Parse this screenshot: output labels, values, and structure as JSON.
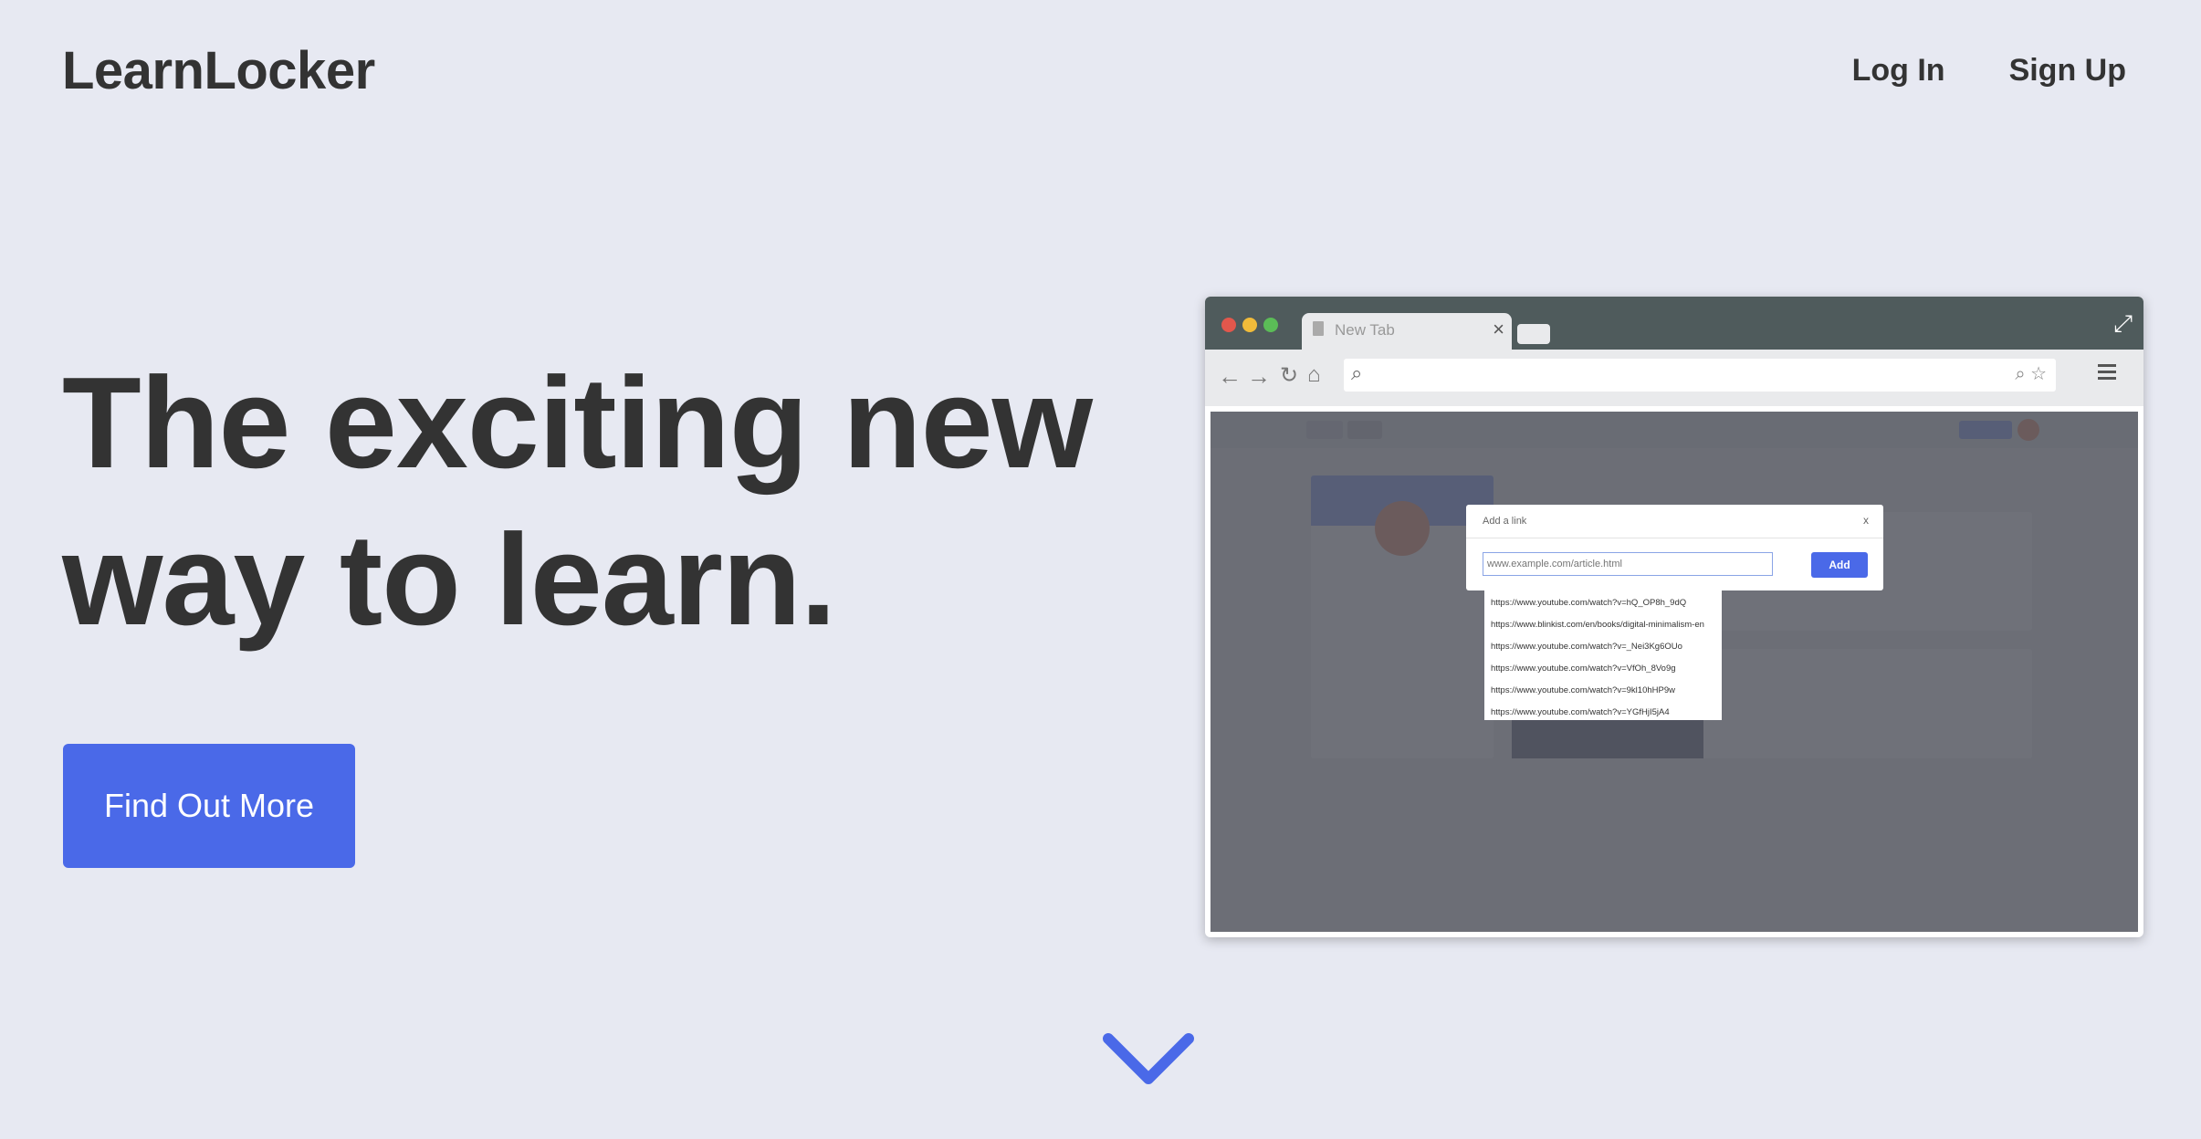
{
  "header": {
    "brand": "LearnLocker",
    "login_label": "Log In",
    "signup_label": "Sign Up"
  },
  "hero": {
    "headline_line1": "The exciting new",
    "headline_line2": "way to learn.",
    "cta_label": "Find Out More"
  },
  "browser_mockup": {
    "tab_title": "New Tab",
    "tab_close": "×",
    "modal": {
      "title": "Add a link",
      "close": "x",
      "input_placeholder": "www.example.com/article.html",
      "add_label": "Add",
      "suggestions": [
        "https://www.youtube.com/watch?v=hQ_OP8h_9dQ",
        "https://www.blinkist.com/en/books/digital-minimalism-en",
        "https://www.youtube.com/watch?v=_Nei3Kg6OUo",
        "https://www.youtube.com/watch?v=VfOh_8Vo9g",
        "https://www.youtube.com/watch?v=9kl10hHP9w",
        "https://www.youtube.com/watch?v=YGfHjI5jA4"
      ]
    }
  },
  "colors": {
    "background": "#e7e9f2",
    "accent": "#4a69e8",
    "text": "#333333"
  },
  "icons": {
    "scroll": "chevron-down-icon"
  }
}
